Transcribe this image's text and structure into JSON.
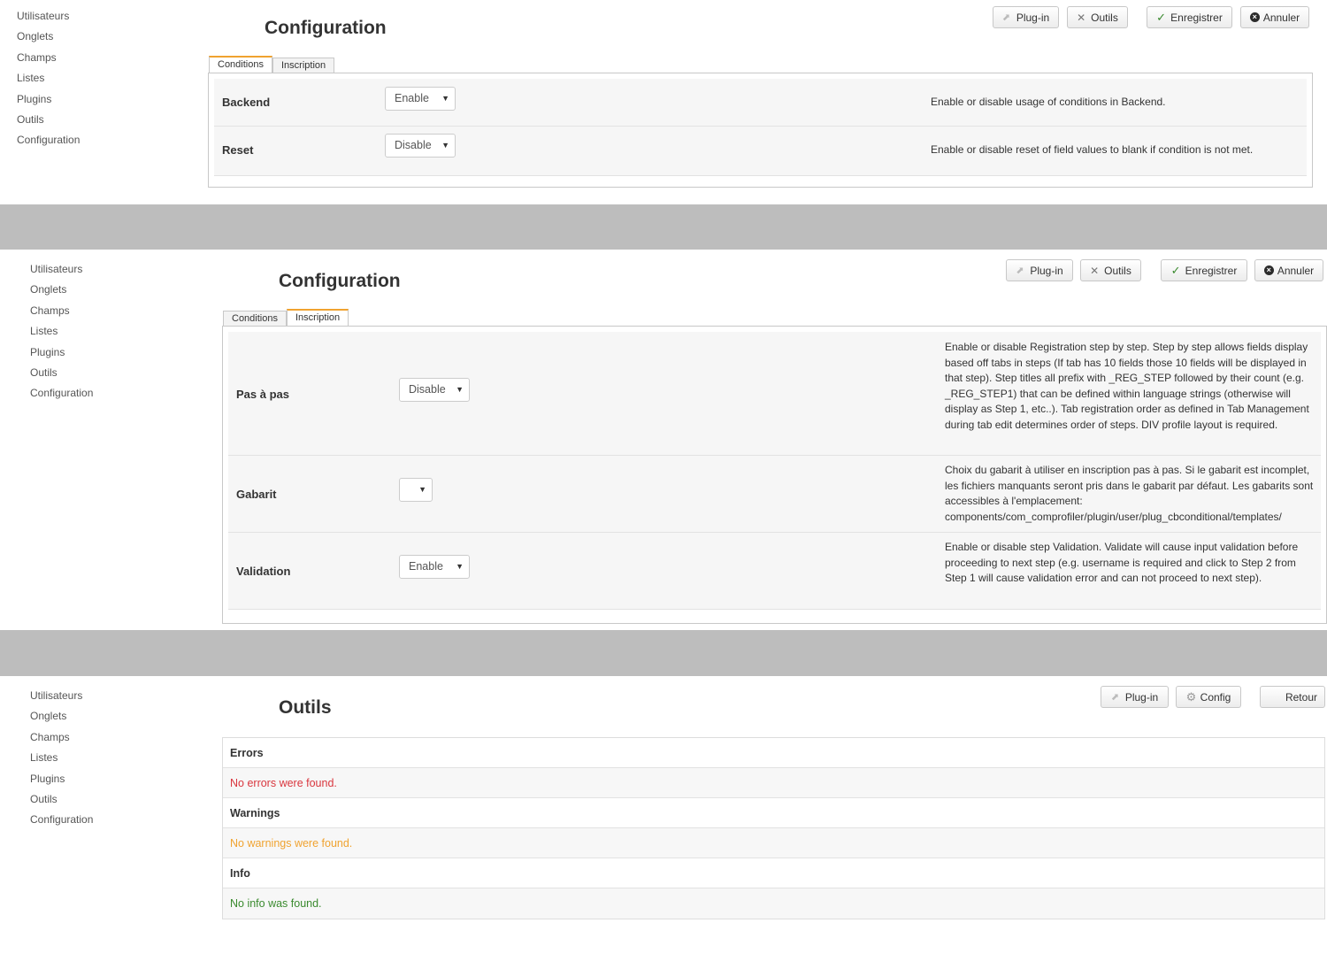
{
  "sidebar_items": [
    "Utilisateurs",
    "Onglets",
    "Champs",
    "Listes",
    "Plugins",
    "Outils",
    "Configuration"
  ],
  "config_page": {
    "title": "Configuration",
    "toolbar": {
      "plugin": "Plug-in",
      "tools": "Outils",
      "save": "Enregistrer",
      "cancel": "Annuler"
    },
    "tabs": [
      "Conditions",
      "Inscription"
    ]
  },
  "panel1": {
    "active_tab": "Conditions",
    "rows": [
      {
        "label": "Backend",
        "value": "Enable",
        "description": "Enable or disable usage of conditions in Backend."
      },
      {
        "label": "Reset",
        "value": "Disable",
        "description": "Enable or disable reset of field values to blank if condition is not met."
      }
    ]
  },
  "panel2": {
    "active_tab": "Inscription",
    "rows": [
      {
        "label": "Pas à pas",
        "value": "Disable",
        "description": "Enable or disable Registration step by step. Step by step allows fields display based off tabs in steps (If tab has 10 fields those 10 fields will be displayed in that step). Step titles all prefix with _REG_STEP followed by their count (e.g. _REG_STEP1) that can be defined within language strings (otherwise will display as Step 1, etc..). Tab registration order as defined in Tab Management during tab edit determines order of steps. DIV profile layout is required."
      },
      {
        "label": "Gabarit",
        "value": "",
        "description": "Choix du gabarit à utiliser en inscription pas à pas. Si le gabarit est incomplet, les fichiers manquants seront pris dans le gabarit par défaut. Les gabarits sont accessibles à l'emplacement: components/com_comprofiler/plugin/user/plug_cbconditional/templates/"
      },
      {
        "label": "Validation",
        "value": "Enable",
        "description": "Enable or disable step Validation. Validate will cause input validation before proceeding to next step (e.g. username is required and click to Step 2 from Step 1 will cause validation error and can not proceed to next step)."
      }
    ]
  },
  "panel3": {
    "title": "Outils",
    "toolbar": {
      "plugin": "Plug-in",
      "config": "Config",
      "back": "Retour"
    },
    "sections": [
      {
        "heading": "Errors",
        "message": "No errors were found.",
        "color": "#d9363e"
      },
      {
        "heading": "Warnings",
        "message": "No warnings were found.",
        "color": "#f0a330"
      },
      {
        "heading": "Info",
        "message": "No info was found.",
        "color": "#3a8a2e"
      }
    ]
  },
  "colors": {
    "separator": "#bdbdbd",
    "active_tab_accent": "#f0a330"
  }
}
